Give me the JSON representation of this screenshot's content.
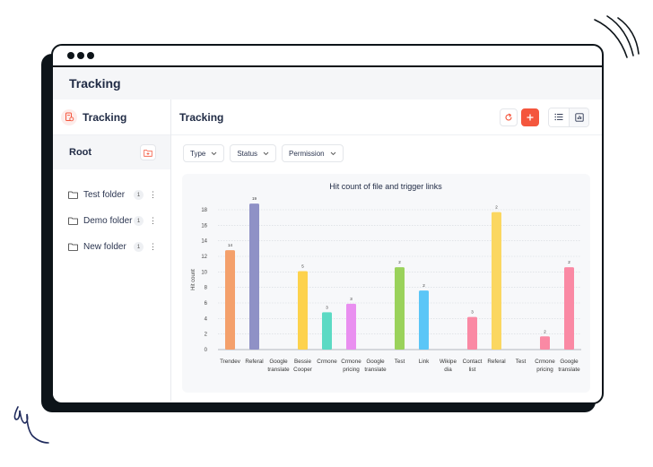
{
  "window": {
    "title": "Tracking"
  },
  "sidebar": {
    "title": "Tracking",
    "root_label": "Root",
    "folders": [
      {
        "name": "Test folder",
        "count": "1"
      },
      {
        "name": "Demo folder",
        "count": "1"
      },
      {
        "name": "New folder",
        "count": "1"
      }
    ]
  },
  "main": {
    "title": "Tracking",
    "filters": [
      {
        "label": "Type"
      },
      {
        "label": "Status"
      },
      {
        "label": "Permission"
      }
    ]
  },
  "colors": {
    "accent": "#f4563d",
    "dark": "#0d1419",
    "text": "#1f2a44"
  },
  "chart_data": {
    "type": "bar",
    "title": "Hit count of file and trigger links",
    "xlabel": "",
    "ylabel": "Hit count",
    "ylim": [
      0,
      18
    ],
    "yticks": [
      0,
      2,
      4,
      6,
      8,
      10,
      12,
      14,
      16,
      18
    ],
    "grid": true,
    "categories": [
      [
        "Trendev"
      ],
      [
        "Referal"
      ],
      [
        "Google",
        "translate"
      ],
      [
        "Bessie",
        "Cooper"
      ],
      [
        "Crmone"
      ],
      [
        "Crmone",
        "pricing"
      ],
      [
        "Google",
        "translate"
      ],
      [
        "Test"
      ],
      [
        "Link"
      ],
      [
        "Wikipe",
        "dia"
      ],
      [
        "Contact",
        "list"
      ],
      [
        "Referal"
      ],
      [
        "Test"
      ],
      [
        "Crmone",
        "pricing"
      ],
      [
        "Google",
        "translate"
      ]
    ],
    "values": [
      12.8,
      18.8,
      null,
      10.1,
      4.8,
      5.9,
      null,
      10.6,
      7.6,
      null,
      4.2,
      17.7,
      0,
      1.7,
      10.6
    ],
    "data_labels": [
      "14",
      "19",
      "",
      "5",
      "3",
      "3",
      "",
      "2",
      "2",
      "",
      "3",
      "2",
      "",
      "2",
      "2"
    ],
    "colors": [
      "#f4a06b",
      "#8f91c6",
      "#f4a06b",
      "#fdd24c",
      "#5cdac4",
      "#e98ff0",
      "#f4a06b",
      "#9ad25b",
      "#5bc6f7",
      "#f4a06b",
      "#fa89a4",
      "#fbd761",
      "#f4a06b",
      "#fa89a4",
      "#fa89a4"
    ]
  }
}
